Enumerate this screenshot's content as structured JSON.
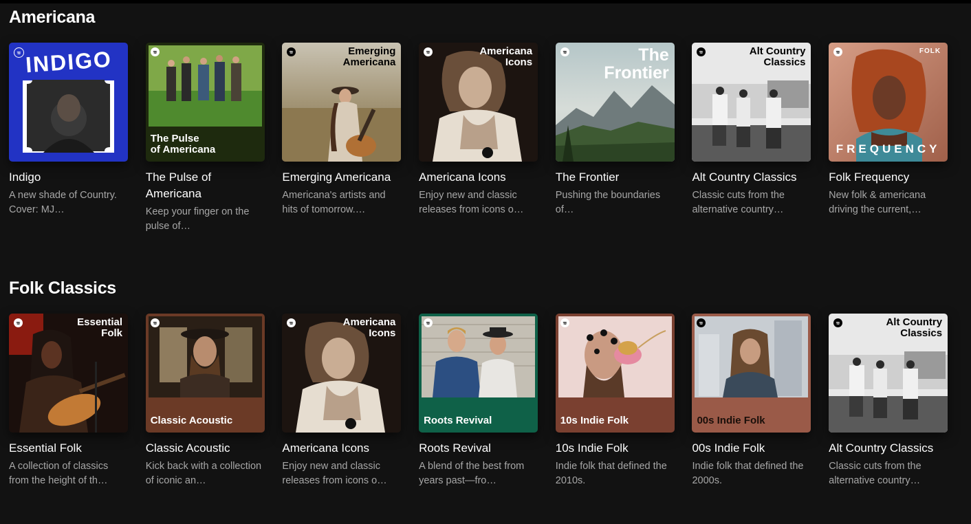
{
  "sections": [
    {
      "title": "Americana",
      "cards": [
        {
          "title": "Indigo",
          "desc": "A new shade of Country. Cover: MJ…",
          "cover_text": "INDIGO"
        },
        {
          "title": "The Pulse of Americana",
          "desc": "Keep your finger on the pulse of…",
          "cover_text": "The Pulse\nof Americana"
        },
        {
          "title": "Emerging Americana",
          "desc": "Americana's artists and hits of tomorrow.…",
          "cover_text": "Emerging\nAmericana"
        },
        {
          "title": "Americana Icons",
          "desc": "Enjoy new and classic releases from icons o…",
          "cover_text": "Americana\nIcons"
        },
        {
          "title": "The Frontier",
          "desc": "Pushing the boundaries of…",
          "cover_text": "The\nFrontier"
        },
        {
          "title": "Alt Country Classics",
          "desc": "Classic cuts from the alternative country…",
          "cover_text": "Alt Country\nClassics"
        },
        {
          "title": "Folk Frequency",
          "desc": "New folk & americana driving the current,…",
          "cover_text": "FREQUENCY",
          "cover_tag": "FOLK"
        }
      ]
    },
    {
      "title": "Folk Classics",
      "cards": [
        {
          "title": "Essential Folk",
          "desc": "A collection of classics from the height of th…",
          "cover_text": "Essential\nFolk"
        },
        {
          "title": "Classic Acoustic",
          "desc": "Kick back with a collection of iconic an…",
          "cover_text": "Classic Acoustic"
        },
        {
          "title": "Americana Icons",
          "desc": "Enjoy new and classic releases from icons o…",
          "cover_text": "Americana\nIcons"
        },
        {
          "title": "Roots Revival",
          "desc": "A blend of the best from years past—fro…",
          "cover_text": "Roots Revival"
        },
        {
          "title": "10s Indie Folk",
          "desc": "Indie folk that defined the 2010s.",
          "cover_text": "10s Indie Folk"
        },
        {
          "title": "00s Indie Folk",
          "desc": "Indie folk that defined the 2000s.",
          "cover_text": "00s Indie Folk"
        },
        {
          "title": "Alt Country Classics",
          "desc": "Classic cuts from the alternative country…",
          "cover_text": "Alt Country\nClassics"
        }
      ]
    }
  ],
  "colors": {
    "background": "#121212",
    "title": "#ffffff",
    "description": "#a7a7a7",
    "indigo": "#2233c4",
    "pulse_band": "#1e2a0e",
    "classic_acoustic_band": "#6b3a26",
    "roots_revival_band": "#0f6148",
    "indie10s_band": "#7a4030",
    "indie00s_band": "#9a5a48"
  }
}
